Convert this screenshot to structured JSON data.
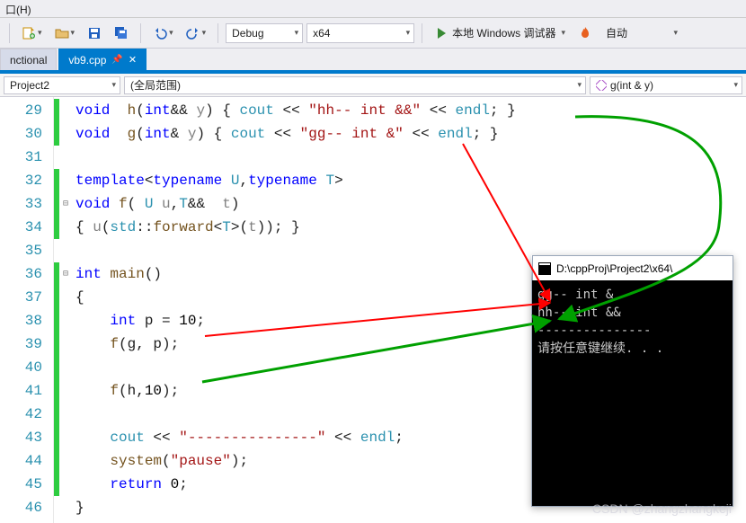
{
  "menu_fragment": "口(H)",
  "toolbar": {
    "config_label": "Debug",
    "platform_label": "x64",
    "run_label": "本地 Windows 调试器",
    "auto_label": "自动"
  },
  "tabs": {
    "background_label": "nctional",
    "active_label": "vb9.cpp"
  },
  "scope": {
    "project": "Project2",
    "scope_label": "(全局范围)",
    "member_label": "g(int & y)"
  },
  "code": {
    "lines": [
      29,
      30,
      31,
      32,
      33,
      34,
      35,
      36,
      37,
      38,
      39,
      40,
      41,
      42,
      43,
      44,
      45,
      46
    ]
  },
  "console": {
    "title": "D:\\cppProj\\Project2\\x64\\",
    "out1": "gg-- int &",
    "out2": "hh-- int &&",
    "sep": "---------------",
    "pause": "请按任意键继续. . ."
  },
  "strings": {
    "hh": "\"hh-- int &&\"",
    "gg": "\"gg-- int &\"",
    "dashes": "\"---------------\"",
    "pause": "\"pause\""
  },
  "watermark": "CSDN @zhangzhangkeji"
}
